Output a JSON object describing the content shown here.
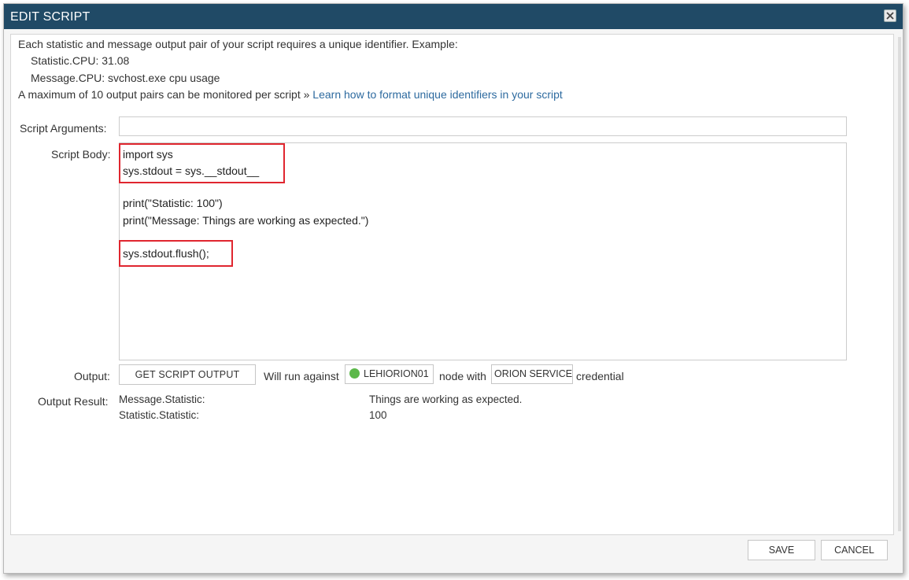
{
  "dialog": {
    "title": "EDIT SCRIPT"
  },
  "intro": {
    "line1": "Each statistic and message output pair of your script requires a unique identifier. Example:",
    "line2": "Statistic.CPU: 31.08",
    "line3": "Message.CPU: svchost.exe cpu usage",
    "line4_prefix": "A maximum of 10 output pairs can be monitored per script »",
    "line4_link": "Learn how to format unique identifiers in your script"
  },
  "form": {
    "script_arguments_label": "Script Arguments:",
    "script_arguments_value": "",
    "script_body_label": "Script Body:",
    "script_body_lines": [
      "import sys",
      "sys.stdout = sys.__stdout__",
      "",
      "print(\"Statistic: 100\")",
      "print(\"Message: Things are working as expected.\")",
      "",
      "sys.stdout.flush();"
    ],
    "output_label": "Output:",
    "get_output_button": "GET SCRIPT OUTPUT",
    "will_run_against": "Will run against",
    "node_name": "LEHIORION01",
    "node_status_color": "#5cb84a",
    "node_with": "node with",
    "credential_name": "ORION SERVICE",
    "credential_suffix": "credential",
    "output_result_label": "Output Result:",
    "results": [
      {
        "key": "Message.Statistic:",
        "value": "Things are working as expected."
      },
      {
        "key": "Statistic.Statistic:",
        "value": "100"
      }
    ]
  },
  "footer": {
    "save_label": "SAVE",
    "cancel_label": "CANCEL"
  },
  "colors": {
    "titlebar": "#204a66",
    "link": "#2d6a9f",
    "highlight_border": "#e0262f"
  }
}
